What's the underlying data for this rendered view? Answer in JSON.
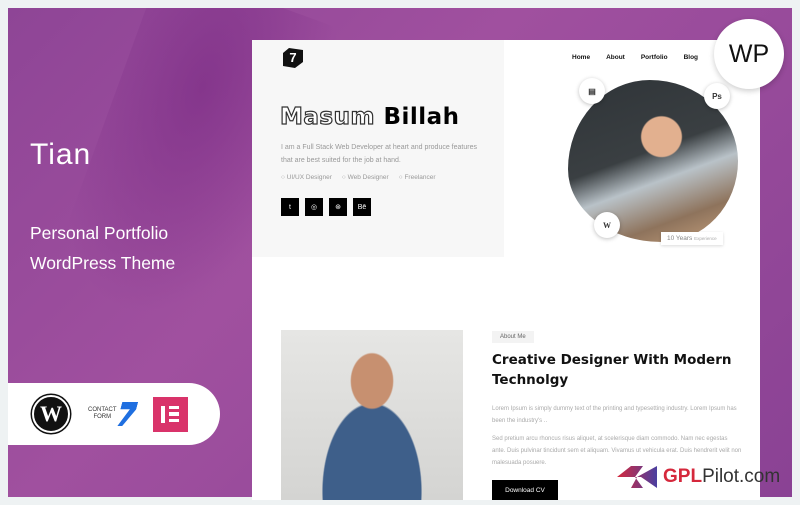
{
  "banner": {
    "title": "Tian",
    "subtitle_line1": "Personal Portfolio",
    "subtitle_line2": "WordPress Theme",
    "wp_badge": "WP"
  },
  "plugins": [
    {
      "icon": "wordpress-icon"
    },
    {
      "icon": "contact-form-7-icon",
      "label_line1": "CONTACT",
      "label_line2": "FORM"
    },
    {
      "icon": "elementor-icon"
    }
  ],
  "site": {
    "logo": "7",
    "nav": [
      "Home",
      "About",
      "Portfolio",
      "Blog"
    ],
    "hero": {
      "name_outline": "Masum",
      "name_bold": "Billah",
      "description": "I am a Full Stack Web Developer at heart and produce features that are best suited for the job at hand.",
      "roles": [
        "UI/UX Designer",
        "Web Designer",
        "Freelancer"
      ],
      "socials": [
        {
          "icon": "twitter-icon",
          "label": "t"
        },
        {
          "icon": "instagram-icon",
          "label": "◎"
        },
        {
          "icon": "dribbble-icon",
          "label": "⊛"
        },
        {
          "icon": "behance-icon",
          "label": "Bē"
        }
      ],
      "badges": [
        "ai-file-icon",
        "Ps",
        "W"
      ],
      "experience_value": "10 Years",
      "experience_label": "Experience"
    },
    "about": {
      "pill": "About Me",
      "heading": "Creative Designer With Modern Technolgy",
      "para1": "Lorem Ipsum is simply dummy text of the printing and typesetting industry. Lorem Ipsum has been the industry's ..",
      "para2": "Sed pretium arcu rhoncus risus aliquet, at scelerisque diam commodo. Nam nec egestas ante. Duis pulvinar tincidunt sem et aliquam. Vivamus ut vehicula erat. Duis hendrerit velit non malesuada posuere.",
      "button": "Download CV"
    }
  },
  "watermark": {
    "brand_red": "GPL",
    "brand_rest": "Pilot.com"
  },
  "colors": {
    "purple": "#9b4c9c",
    "elementor": "#d9336a",
    "cf7": "#1f6fe0",
    "gpl_red": "#d5283c"
  }
}
